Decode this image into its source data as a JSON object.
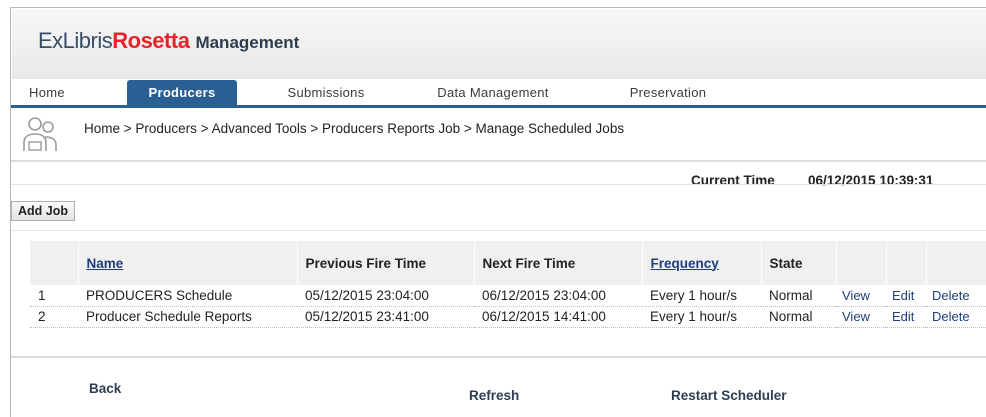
{
  "app": {
    "logo_ex": "ExLibris",
    "logo_rosetta": "Rosetta",
    "logo_management": "Management"
  },
  "tabs": [
    {
      "label": "Home",
      "active": false
    },
    {
      "label": "Producers",
      "active": true
    },
    {
      "label": "Submissions",
      "active": false
    },
    {
      "label": "Data Management",
      "active": false
    },
    {
      "label": "Preservation",
      "active": false
    }
  ],
  "breadcrumb": "Home > Producers > Advanced Tools > Producers Reports Job > Manage Scheduled Jobs",
  "current_time": {
    "label": "Current Time",
    "value": "06/12/2015 10:39:31"
  },
  "add_job_label": "Add Job",
  "table": {
    "headers": [
      "",
      "Name",
      "Previous Fire Time",
      "Next Fire Time",
      "Frequency",
      "State",
      "",
      "",
      ""
    ],
    "rows": [
      {
        "num": "1",
        "name": "PRODUCERS Schedule",
        "prev": "05/12/2015 23:04:00",
        "next": "06/12/2015 23:04:00",
        "freq": "Every 1 hour/s",
        "state": "Normal",
        "view": "View",
        "edit": "Edit",
        "delete": "Delete"
      },
      {
        "num": "2",
        "name": "Producer Schedule Reports",
        "prev": "05/12/2015 23:41:00",
        "next": "06/12/2015 14:41:00",
        "freq": "Every 1 hour/s",
        "state": "Normal",
        "view": "View",
        "edit": "Edit",
        "delete": "Delete"
      }
    ]
  },
  "footer": {
    "back": "Back",
    "refresh": "Refresh",
    "restart": "Restart Scheduler"
  },
  "colors": {
    "tab_active": "#2a5f93",
    "brand_red": "#e8242a",
    "link": "#1f3f7a"
  },
  "icons": {
    "breadcrumb_icon": "people-icon"
  }
}
